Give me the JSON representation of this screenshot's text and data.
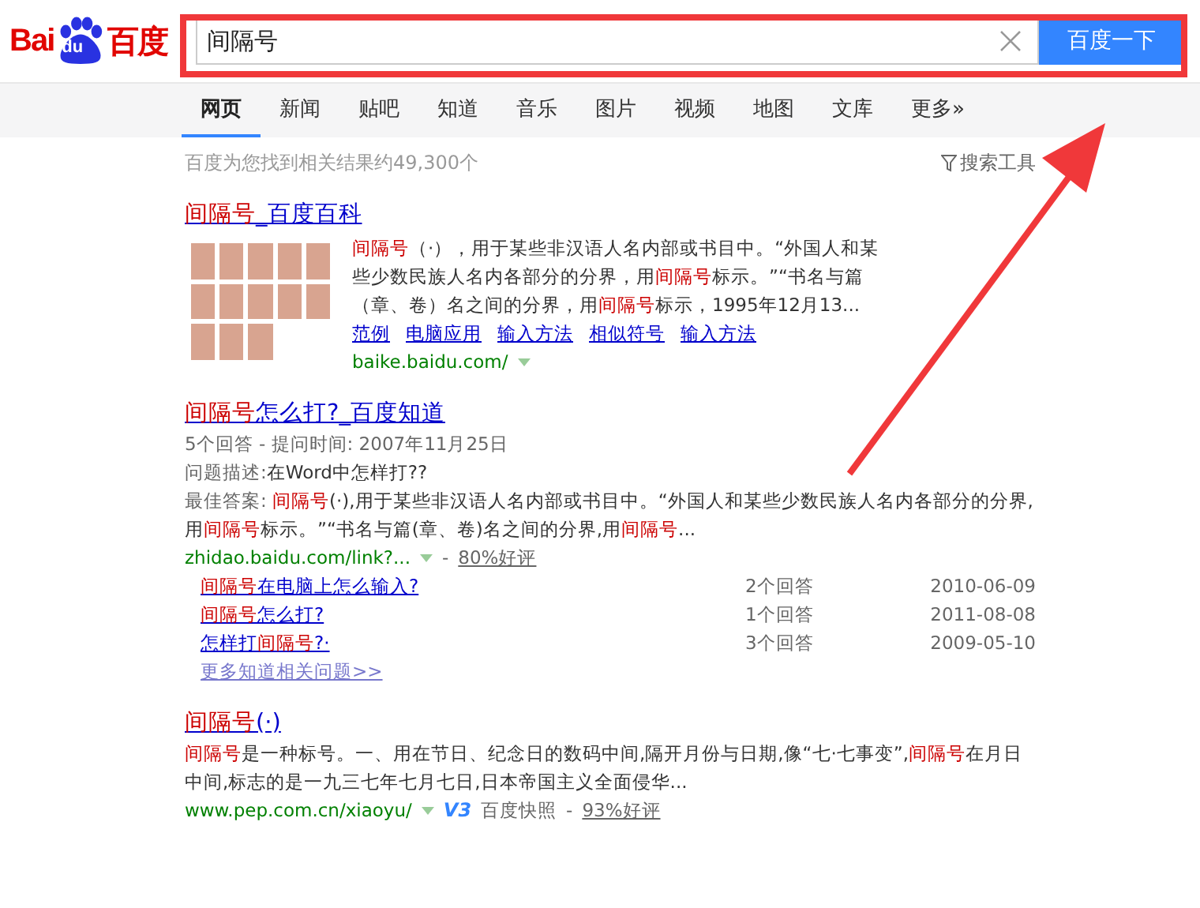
{
  "logo": {
    "left": "Bai",
    "paw": "du",
    "right": "百度"
  },
  "search": {
    "value": "间隔号",
    "button": "百度一下"
  },
  "tabs": [
    {
      "label": "网页",
      "selected": true
    },
    {
      "label": "新闻",
      "selected": false
    },
    {
      "label": "贴吧",
      "selected": false
    },
    {
      "label": "知道",
      "selected": false
    },
    {
      "label": "音乐",
      "selected": false
    },
    {
      "label": "图片",
      "selected": false
    },
    {
      "label": "视频",
      "selected": false
    },
    {
      "label": "地图",
      "selected": false
    },
    {
      "label": "文库",
      "selected": false
    },
    {
      "label": "更多»",
      "selected": false
    }
  ],
  "result_count": "百度为您找到相关结果约49,300个",
  "search_tools": "搜索工具",
  "results": [
    {
      "kind": "baike",
      "title": [
        {
          "text": "间隔号",
          "hl": true
        },
        {
          "text": "_百度百科",
          "hl": false
        }
      ],
      "snippet": [
        {
          "text": "间隔号",
          "hl": true
        },
        {
          "text": "（·），用于某些非汉语人名内部或书目中。“外国人和某些少数民族人名内各部分的分界，用",
          "hl": false
        },
        {
          "text": "间隔号",
          "hl": true
        },
        {
          "text": "标示。”“书名与篇（章、卷）名之间的分界，用",
          "hl": false
        },
        {
          "text": "间隔号",
          "hl": true
        },
        {
          "text": "标示，1995年12月13...",
          "hl": false
        }
      ],
      "links": [
        "范例",
        "电脑应用",
        "输入方法",
        "相似符号",
        "输入方法"
      ],
      "url": "baike.baidu.com/"
    },
    {
      "kind": "zhidao",
      "title": [
        {
          "text": "间隔号",
          "hl": true
        },
        {
          "text": "怎么打?_百度知道",
          "hl": false
        }
      ],
      "meta": "5个回答 - 提问时间: 2007年11月25日",
      "question_label": "问题描述:",
      "question": "在Word中怎样打??",
      "answer_label": "最佳答案:",
      "snippet": [
        {
          "text": "间隔号",
          "hl": true
        },
        {
          "text": "(·),用于某些非汉语人名内部或书目中。“外国人和某些少数民族人名内各部分的分界,用",
          "hl": false
        },
        {
          "text": "间隔号",
          "hl": true
        },
        {
          "text": "标示。”“书名与篇(章、卷)名之间的分界,用",
          "hl": false
        },
        {
          "text": "间隔号",
          "hl": true
        },
        {
          "text": "...",
          "hl": false
        }
      ],
      "url": "zhidao.baidu.com/link?...",
      "separator": "-",
      "rating": "80%好评",
      "related": [
        {
          "title": [
            {
              "text": "间隔号",
              "hl": true
            },
            {
              "text": "在电脑上怎么输入?",
              "hl": false
            }
          ],
          "answers": "2个回答",
          "date": "2010-06-09"
        },
        {
          "title": [
            {
              "text": "间隔号",
              "hl": true
            },
            {
              "text": "怎么打?",
              "hl": false
            }
          ],
          "answers": "1个回答",
          "date": "2011-08-08"
        },
        {
          "title": [
            {
              "text": "怎样打",
              "hl": false
            },
            {
              "text": "间隔号",
              "hl": true
            },
            {
              "text": "?·",
              "hl": false
            }
          ],
          "answers": "3个回答",
          "date": "2009-05-10"
        }
      ],
      "more": "更多知道相关问题>>"
    },
    {
      "kind": "web",
      "title": [
        {
          "text": "间隔号",
          "hl": true
        },
        {
          "text": "(·)",
          "hl": false
        }
      ],
      "snippet": [
        {
          "text": "间隔号",
          "hl": true
        },
        {
          "text": "是一种标号。一、用在节日、纪念日的数码中间,隔开月份与日期,像“七·七事变”,",
          "hl": false
        },
        {
          "text": "间隔号",
          "hl": true
        },
        {
          "text": "在月日中间,标志的是一九三七年七月七日,日本帝国主义全面侵华...",
          "hl": false
        }
      ],
      "url": "www.pep.com.cn/xiaoyu/",
      "badge": "V3",
      "cache": "百度快照",
      "separator": "-",
      "rating": "93%好评"
    }
  ]
}
